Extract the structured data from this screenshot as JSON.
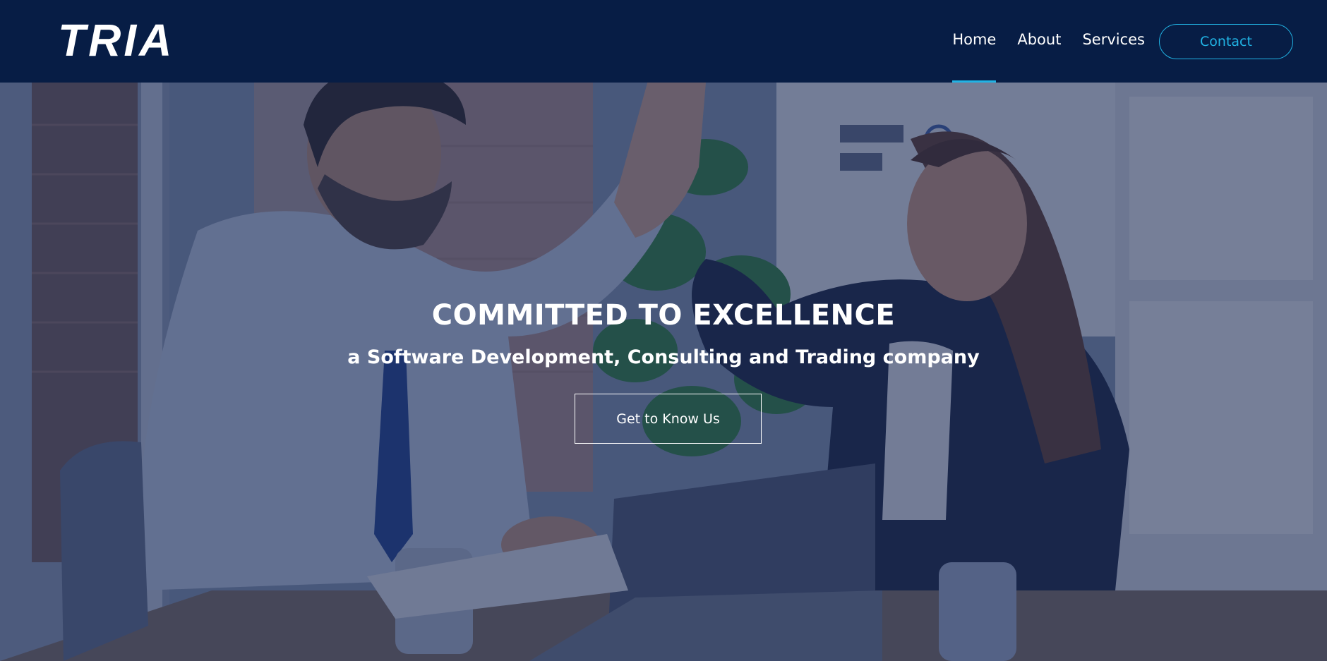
{
  "brand": {
    "logo_text": "TRIA"
  },
  "nav": {
    "items": [
      {
        "label": "Home",
        "active": true
      },
      {
        "label": "About",
        "active": false
      },
      {
        "label": "Services",
        "active": false
      }
    ],
    "contact_label": "Contact"
  },
  "hero": {
    "title": "COMMITTED TO EXCELLENCE",
    "subtitle": "a Software Development, Consulting and Trading company",
    "cta_label": "Get to Know Us",
    "image_semantic": "business-people-high-five-photo"
  },
  "colors": {
    "header_bg": "#071d45",
    "accent": "#21b3e4",
    "overlay": "rgba(14,30,72,0.55)",
    "text": "#ffffff"
  }
}
